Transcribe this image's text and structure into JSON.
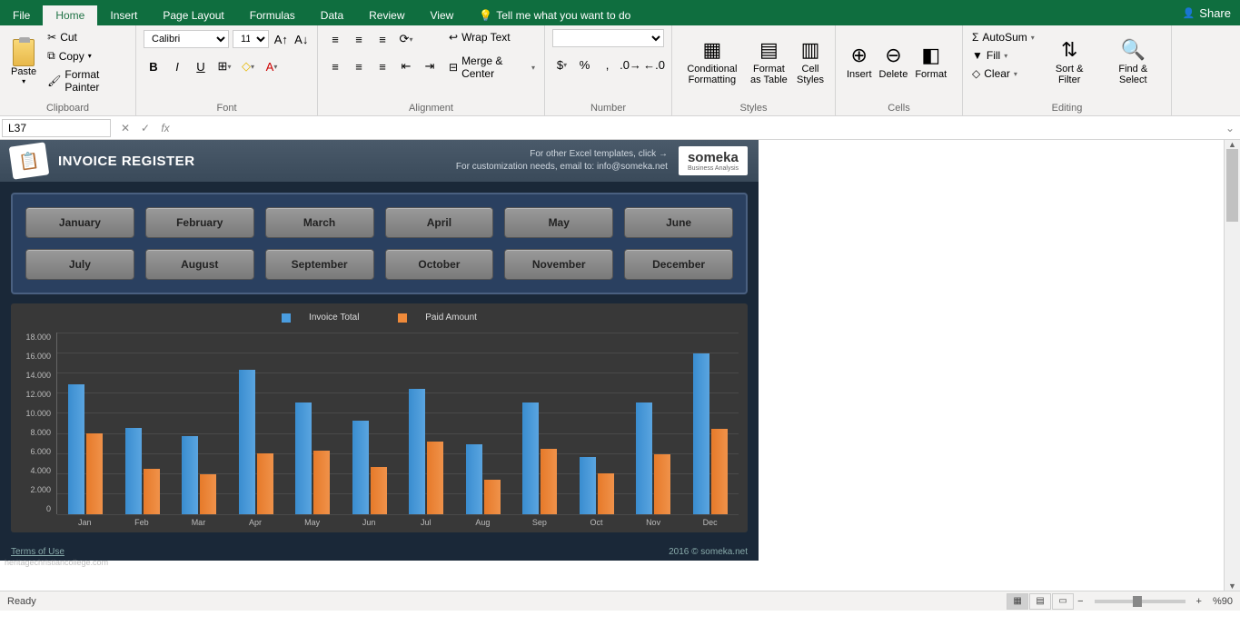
{
  "app": {
    "share": "Share"
  },
  "tabs": [
    "File",
    "Home",
    "Insert",
    "Page Layout",
    "Formulas",
    "Data",
    "Review",
    "View"
  ],
  "active_tab": "Home",
  "tell_me": "Tell me what you want to do",
  "ribbon": {
    "clipboard": {
      "paste": "Paste",
      "cut": "Cut",
      "copy": "Copy",
      "format_painter": "Format Painter",
      "label": "Clipboard"
    },
    "font": {
      "name": "Calibri",
      "size": "11",
      "label": "Font"
    },
    "alignment": {
      "wrap": "Wrap Text",
      "merge": "Merge & Center",
      "label": "Alignment"
    },
    "number": {
      "label": "Number"
    },
    "styles": {
      "cond": "Conditional Formatting",
      "table": "Format as Table",
      "cell": "Cell Styles",
      "label": "Styles"
    },
    "cells": {
      "insert": "Insert",
      "delete": "Delete",
      "format": "Format",
      "label": "Cells"
    },
    "editing": {
      "autosum": "AutoSum",
      "fill": "Fill",
      "clear": "Clear",
      "sort": "Sort & Filter",
      "find": "Find & Select",
      "label": "Editing"
    }
  },
  "formula_bar": {
    "cell_ref": "L37",
    "content": ""
  },
  "dashboard": {
    "title": "INVOICE REGISTER",
    "tip1": "For other Excel templates, click →",
    "tip2": "For customization needs, email to: info@someka.net",
    "logo": "someka",
    "logo_sub": "Business Analysis",
    "months": [
      "January",
      "February",
      "March",
      "April",
      "May",
      "June",
      "July",
      "August",
      "September",
      "October",
      "November",
      "December"
    ],
    "legend_invoice": "Invoice Total",
    "legend_paid": "Paid Amount",
    "terms": "Terms of Use",
    "copyright": "2016 © someka.net",
    "watermark": "heritagechristiancollege.com"
  },
  "chart_data": {
    "type": "bar",
    "title": "",
    "categories": [
      "Jan",
      "Feb",
      "Mar",
      "Apr",
      "May",
      "Jun",
      "Jul",
      "Aug",
      "Sep",
      "Oct",
      "Nov",
      "Dec"
    ],
    "series": [
      {
        "name": "Invoice Total",
        "color": "#4a9de0",
        "values": [
          12800,
          8500,
          7700,
          14300,
          11000,
          9200,
          12400,
          6900,
          11000,
          5600,
          11000,
          15900
        ]
      },
      {
        "name": "Paid Amount",
        "color": "#ef8a3a",
        "values": [
          8000,
          4500,
          3900,
          6000,
          6300,
          4600,
          7200,
          3400,
          6400,
          4000,
          5900,
          8400
        ]
      }
    ],
    "ylabel": "",
    "xlabel": "",
    "ylim": [
      0,
      18000
    ],
    "y_ticks": [
      "18.000",
      "16.000",
      "14.000",
      "12.000",
      "10.000",
      "8.000",
      "6.000",
      "4.000",
      "2.000",
      "0"
    ]
  },
  "statusbar": {
    "ready": "Ready",
    "zoom": "%90"
  }
}
